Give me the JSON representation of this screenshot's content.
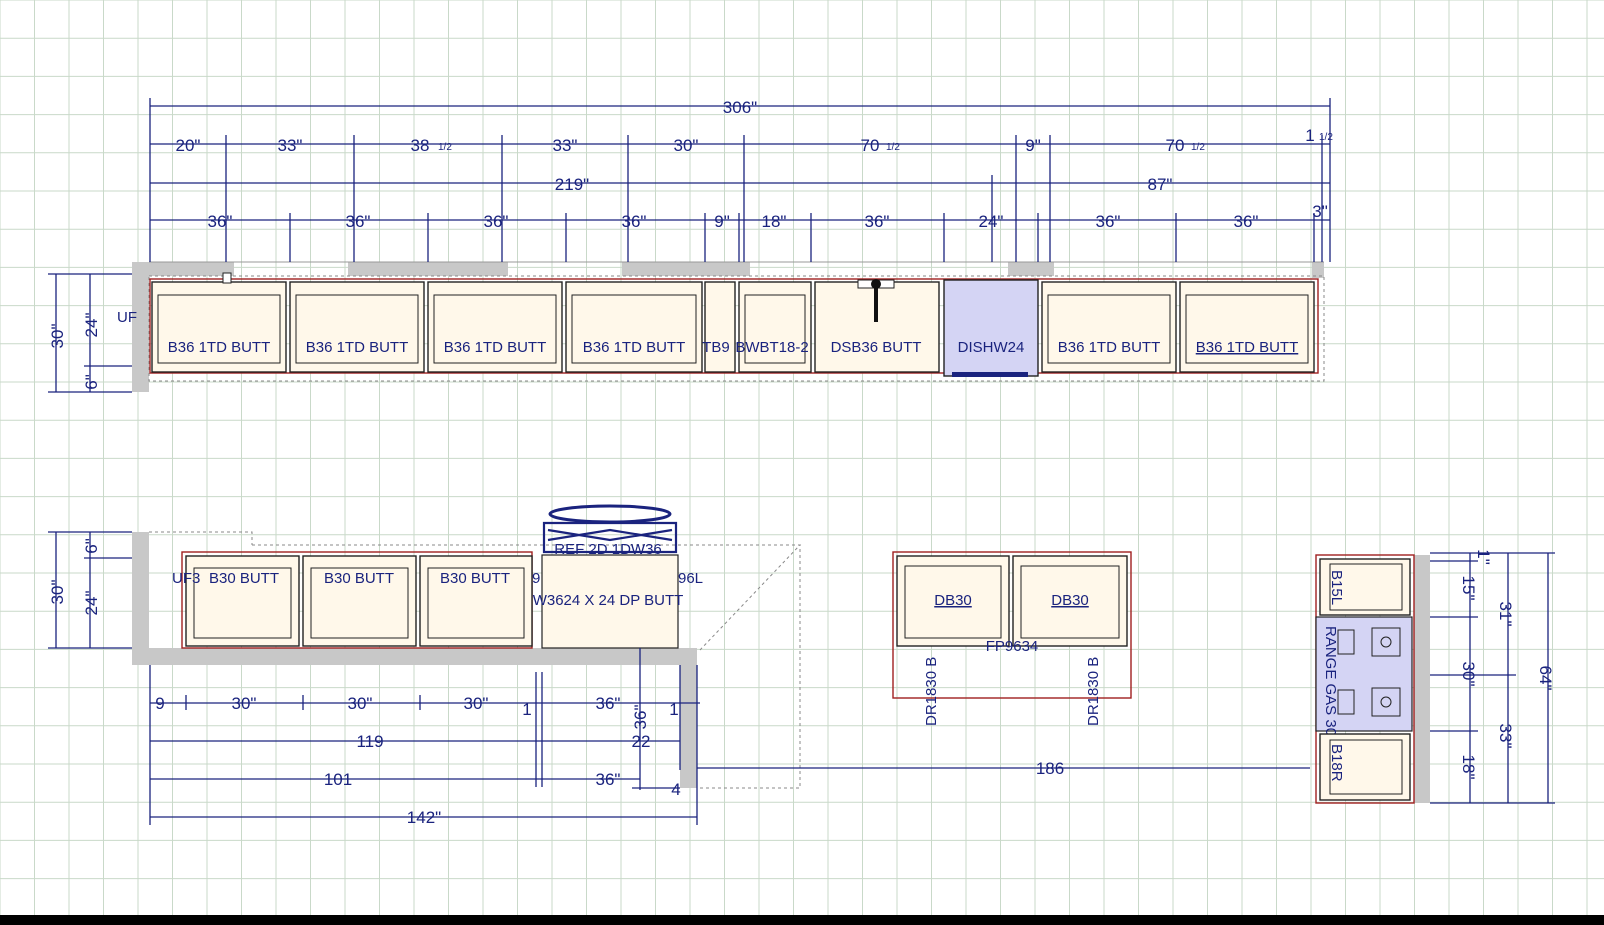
{
  "top_run": {
    "overall": "306\"",
    "row1": [
      "20\"",
      "33\"",
      "38",
      "33\"",
      "30\"",
      "70",
      "9\"",
      "70",
      "1"
    ],
    "row1_fracs": [
      "1/2",
      "1/2",
      "1/2",
      "1/2"
    ],
    "row2": [
      "219\"",
      "87\""
    ],
    "row3": [
      "36\"",
      "36\"",
      "36\"",
      "36\"",
      "9\"",
      "18\"",
      "36\"",
      "24\"",
      "36\"",
      "36\"",
      "3\""
    ],
    "left_dims": [
      "30\"",
      "24\"",
      "6\""
    ],
    "uf_label": "UF",
    "cabinets": [
      "B36 1TD BUTT",
      "B36 1TD BUTT",
      "B36 1TD BUTT",
      "B36 1TD BUTT",
      "TB9",
      "BWBT18-2",
      "DSB36 BUTT",
      "DISHW24",
      "B36 1TD BUTT",
      "B36 1TD BUTT"
    ]
  },
  "bottom_run": {
    "left_dims": [
      "30\"",
      "24\"",
      "6\""
    ],
    "cabinets": [
      "UF3",
      "B30 BUTT",
      "B30 BUTT",
      "B30 BUTT",
      "REF 2D 1DW36",
      "W3624 X 24 DP BUTT",
      "96L",
      "9"
    ],
    "row1": [
      "9",
      "30\"",
      "30\"",
      "30\"",
      "1",
      "36\"",
      "1"
    ],
    "row2": [
      "119",
      "22"
    ],
    "row3": [
      "101",
      "36\""
    ],
    "overall": "142\"",
    "vert": [
      "36\"",
      "4"
    ]
  },
  "island": {
    "cabinets": [
      "DB30",
      "DB30"
    ],
    "panel": "FP9634",
    "side_labels": [
      "DR1830 B",
      "DR1830 B"
    ],
    "span": "186"
  },
  "range_run": {
    "cabinets": [
      "B15L",
      "RANGE GAS 30",
      "B18R"
    ],
    "dims_inner": [
      "1\"",
      "15\"",
      "30\"",
      "18\""
    ],
    "dims_mid": [
      "31\"",
      "33\""
    ],
    "overall": "64\""
  },
  "colors": {
    "dimension": "#1a237e",
    "grid": "#c9d9c9",
    "wall": "#c8c8c8",
    "appliance_fill": "#d4d4f4",
    "cabinet_outline": "#a02020"
  }
}
